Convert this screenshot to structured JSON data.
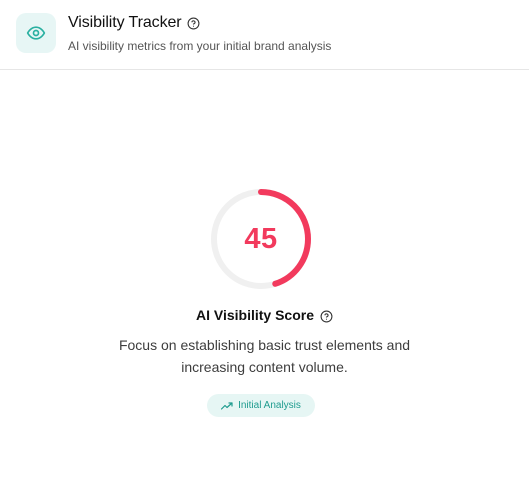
{
  "header": {
    "icon": "eye-icon",
    "title": "Visibility Tracker",
    "help_icon": "help-circle-icon",
    "subtitle": "AI visibility metrics from your initial brand analysis"
  },
  "score": {
    "value": "45",
    "fraction": 0.45,
    "label": "AI Visibility Score",
    "help_icon": "help-circle-icon",
    "description": "Focus on establishing basic trust elements and increasing content volume."
  },
  "badge": {
    "icon": "trending-up-icon",
    "label": "Initial Analysis"
  },
  "colors": {
    "accent": "#2ab0a1",
    "accent_bg": "#e7f6f5",
    "score": "#f23a5d",
    "track": "#f0f0f0"
  }
}
